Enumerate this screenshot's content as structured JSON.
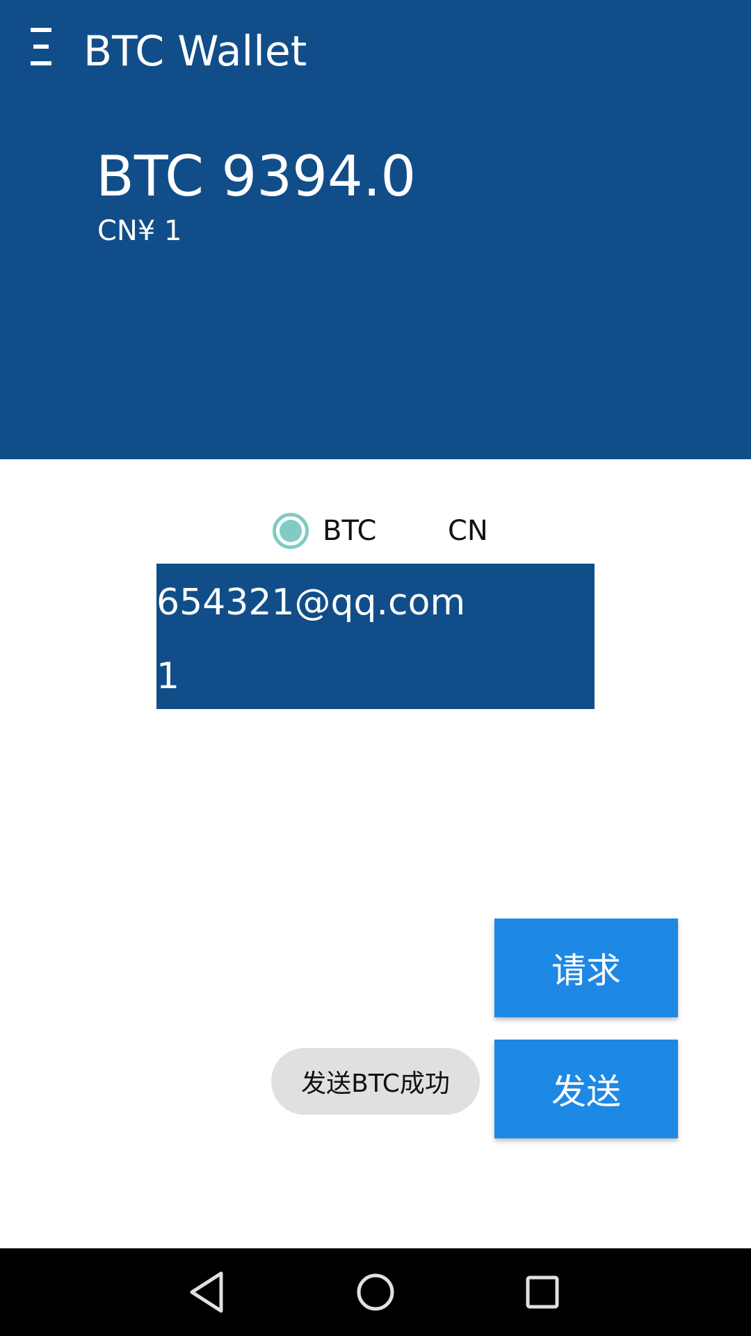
{
  "header": {
    "title": "BTC Wallet",
    "balance_btc": "BTC 9394.0",
    "balance_fiat": "CN¥  1"
  },
  "currency_selector": {
    "options": [
      {
        "label": "BTC",
        "selected": true
      },
      {
        "label": "CN",
        "selected": false
      }
    ]
  },
  "form": {
    "email_value": "654321@qq.com",
    "amount_value": "1"
  },
  "buttons": {
    "request_label": "请求",
    "send_label": "发送"
  },
  "toast": {
    "message": "发送BTC成功"
  },
  "colors": {
    "header_bg": "#114E89",
    "button_bg": "#1E88E5",
    "radio_accent": "#80CBC4",
    "toast_bg": "#E0E0E0"
  },
  "icons": {
    "menu": "menu-icon",
    "nav_back": "back-triangle-icon",
    "nav_home": "home-circle-icon",
    "nav_recent": "recent-square-icon"
  }
}
